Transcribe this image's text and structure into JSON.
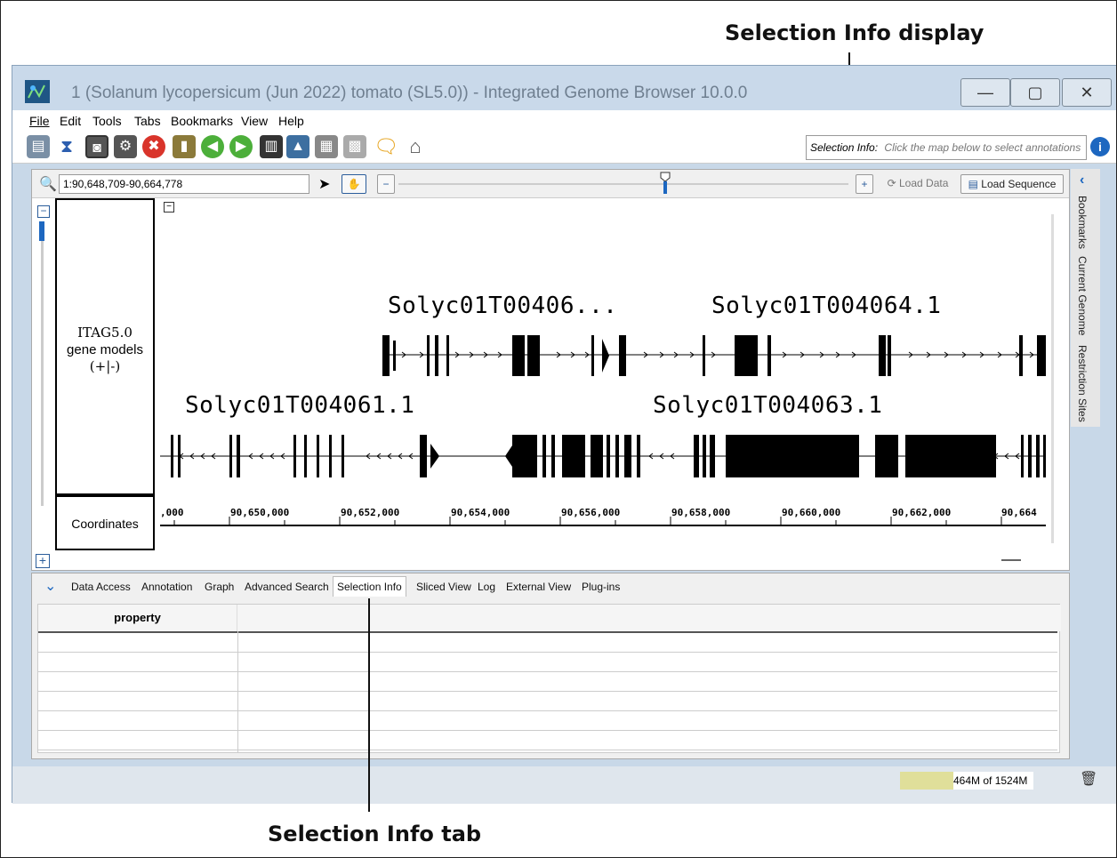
{
  "callouts": {
    "selection_display": "Selection Info display",
    "selection_tab": "Selection Info tab"
  },
  "window": {
    "title": "1  (Solanum lycopersicum (Jun 2022) tomato (SL5.0)) - Integrated Genome Browser 10.0.0",
    "minimize": "—",
    "maximize": "▢",
    "close": "✕"
  },
  "menu": {
    "file": "File",
    "edit": "Edit",
    "tools": "Tools",
    "tabs": "Tabs",
    "bookmarks": "Bookmarks",
    "view": "View",
    "help": "Help"
  },
  "selection_info": {
    "label": "Selection Info:",
    "hint": "Click the map below to select annotations",
    "info_icon": "i"
  },
  "nav": {
    "sequence_range": "1:90,648,709-90,664,778",
    "load_data": "Load Data",
    "load_sequence": "Load Sequence"
  },
  "tracks": {
    "gene_track_label_lines": [
      "ITAG5.0",
      "gene models",
      "(+|-)"
    ],
    "coord_track_label": "Coordinates"
  },
  "genes": {
    "g1": "Solyc01T00406...",
    "g2": "Solyc01T004064.1",
    "g3": "Solyc01T004061.1",
    "g4": "Solyc01T004063.1"
  },
  "coordinates": [
    ",000",
    "90,650,000",
    "90,652,000",
    "90,654,000",
    "90,656,000",
    "90,658,000",
    "90,660,000",
    "90,662,000",
    "90,664"
  ],
  "side_tabs": [
    "Bookmarks",
    "Current Genome",
    "Restriction Sites"
  ],
  "bottom_tabs": [
    "Data Access",
    "Annotation",
    "Graph",
    "Advanced Search",
    "Selection Info",
    "Sliced View",
    "Log",
    "External View",
    "Plug-ins"
  ],
  "active_bottom_tab": "Selection Info",
  "table": {
    "header_property": "property",
    "header_value": ""
  },
  "status": {
    "memory": "464M of 1524M"
  }
}
